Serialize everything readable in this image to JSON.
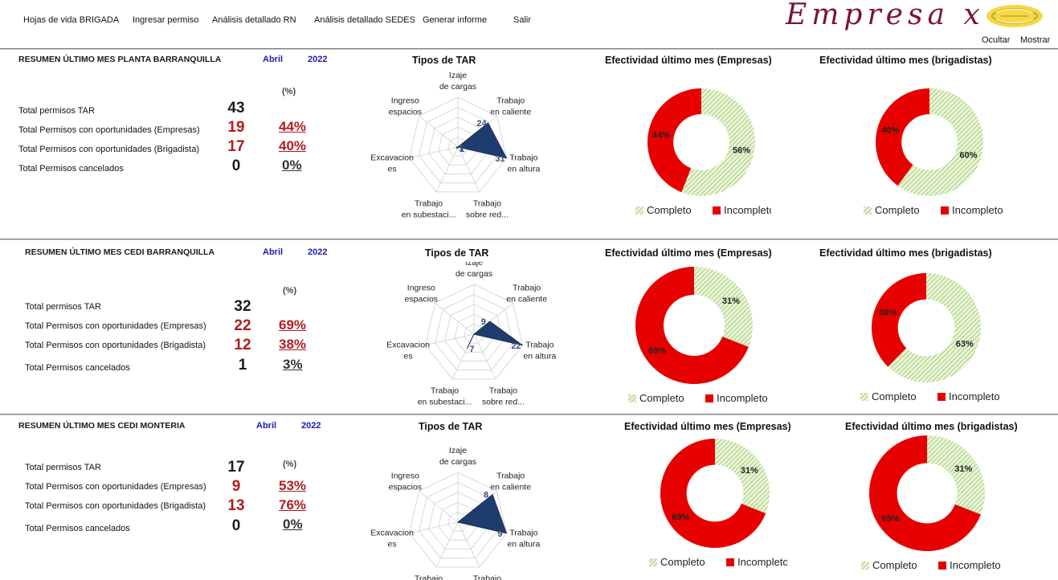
{
  "nav": [
    "Hojas de vida BRIGADA",
    "Ingresar permiso",
    "Análisis detallado RN",
    "Análisis detallado SEDES",
    "Generar informe",
    "Salir"
  ],
  "logo": {
    "text": "Empresa x"
  },
  "controls": {
    "hide": "Ocultar",
    "show": "Mostrar"
  },
  "common": {
    "pct_header": "(%)",
    "radar_title": "Tipos de TAR",
    "radar_axes": [
      "Izaje de cargas",
      "Trabajo en caliente",
      "Trabajo en altura",
      "Trabajo sobre red...",
      "Trabajo en subestaci...",
      "Excavaciones",
      "Ingreso espacios"
    ],
    "legend_complete": "Completo",
    "legend_incomplete": "Incompleto"
  },
  "colors": {
    "complete": "#a9d17a",
    "incomplete": "#e60000",
    "brand": "#7a1530",
    "radar_fill": "#1f3c6e",
    "accent_red": "#b01c1c",
    "accent_blue": "#1b1bb3"
  },
  "sections": [
    {
      "title": "RESUMEN ÚLTIMO MES  PLANTA BARRANQUILLA",
      "month": "Abril",
      "year": "2022",
      "rows": [
        {
          "label": "Total permisos TAR",
          "value": "43",
          "pct": ""
        },
        {
          "label": "Total Permisos con oportunidades (Empresas)",
          "value": "19",
          "pct": "44%"
        },
        {
          "label": "Total Permisos con oportunidades (Brigadista)",
          "value": "17",
          "pct": "40%"
        },
        {
          "label": "Total Permisos cancelados",
          "value": "0",
          "pct": "0%"
        }
      ],
      "eff_empresas_title": "Efectividad  último mes (Empresas)",
      "eff_brigadistas_title": "Efectividad  último mes (brigadistas)"
    },
    {
      "title": "RESUMEN ÚLTIMO MES  CEDI BARRANQUILLA",
      "month": "Abril",
      "year": "2022",
      "rows": [
        {
          "label": "Total permisos TAR",
          "value": "32",
          "pct": ""
        },
        {
          "label": "Total Permisos con oportunidades (Empresas)",
          "value": "22",
          "pct": "69%"
        },
        {
          "label": "Total Permisos con oportunidades (Brigadista)",
          "value": "12",
          "pct": "38%"
        },
        {
          "label": "Total Permisos cancelados",
          "value": "1",
          "pct": "3%"
        }
      ],
      "eff_empresas_title": "Efectividad  último mes (Empresas)",
      "eff_brigadistas_title": "Efectividad  último mes (brigadistas)"
    },
    {
      "title": "RESUMEN ÚLTIMO MES  CEDI MONTERIA",
      "month": "Abril",
      "year": "2022",
      "rows": [
        {
          "label": "Total permisos TAR",
          "value": "17",
          "pct": "(%)"
        },
        {
          "label": "Total Permisos con oportunidades (Empresas)",
          "value": "9",
          "pct": "53%"
        },
        {
          "label": "Total Permisos con oportunidades (Brigadista)",
          "value": "13",
          "pct": "76%"
        },
        {
          "label": "Total Permisos cancelados",
          "value": "0",
          "pct": "0%"
        }
      ],
      "eff_empresas_title": "Efectividad  último mes (Empresas)",
      "eff_brigadistas_title": "Efectividad  último mes (brigadistas)"
    }
  ],
  "chart_data": [
    {
      "type": "radar",
      "title": "Tipos de TAR",
      "categories": [
        "Izaje de cargas",
        "Trabajo en caliente",
        "Trabajo en altura",
        "Trabajo sobre red...",
        "Trabajo en subestaci...",
        "Excavaciones",
        "Ingreso espacios"
      ],
      "values": [
        0,
        24,
        31,
        0,
        1,
        1,
        0
      ],
      "labels": [
        "",
        "24",
        "31",
        "",
        "1",
        "1",
        ""
      ]
    },
    {
      "type": "pie",
      "title": "Efectividad  último mes (Empresas)",
      "categories": [
        "Completo",
        "Incompleto"
      ],
      "values": [
        56,
        44
      ],
      "labels": [
        "56%",
        "44%"
      ]
    },
    {
      "type": "pie",
      "title": "Efectividad  último mes (brigadistas)",
      "categories": [
        "Completo",
        "Incompleto"
      ],
      "values": [
        60,
        40
      ],
      "labels": [
        "60%",
        "40%"
      ]
    },
    {
      "type": "radar",
      "title": "Tipos de TAR",
      "categories": [
        "Izaje de cargas",
        "Trabajo en caliente",
        "Trabajo en altura",
        "Trabajo sobre red...",
        "Trabajo en subestaci...",
        "Excavaciones",
        "Ingreso espacios"
      ],
      "values": [
        0,
        9,
        22,
        0,
        7,
        0,
        0
      ],
      "labels": [
        "",
        "9",
        "22",
        "",
        "7",
        "",
        ""
      ]
    },
    {
      "type": "pie",
      "title": "Efectividad  último mes (Empresas)",
      "categories": [
        "Completo",
        "Incompleto"
      ],
      "values": [
        31,
        69
      ],
      "labels": [
        "31%",
        "69%"
      ]
    },
    {
      "type": "pie",
      "title": "Efectividad  último mes (brigadistas)",
      "categories": [
        "Completo",
        "Incompleto"
      ],
      "values": [
        63,
        38
      ],
      "labels": [
        "63%",
        "38%"
      ]
    },
    {
      "type": "radar",
      "title": "Tipos de TAR",
      "categories": [
        "Izaje de cargas",
        "Trabajo en caliente",
        "Trabajo en altura",
        "Trabajo sobre red...",
        "Trabajo en subestaci...",
        "Excavaciones",
        "Ingreso espacios"
      ],
      "values": [
        0,
        8,
        9,
        0,
        0,
        0,
        0
      ],
      "labels": [
        "",
        "8",
        "9",
        "",
        "",
        "",
        ""
      ]
    },
    {
      "type": "pie",
      "title": "Efectividad  último mes (Empresas)",
      "categories": [
        "Completo",
        "Incompleto"
      ],
      "values": [
        31,
        69
      ],
      "labels": [
        "31%",
        "69%"
      ]
    },
    {
      "type": "pie",
      "title": "Efectividad  último mes (brigadistas)",
      "categories": [
        "Completo",
        "Incompleto"
      ],
      "values": [
        31,
        69
      ],
      "labels": [
        "31%",
        "69%"
      ]
    }
  ]
}
